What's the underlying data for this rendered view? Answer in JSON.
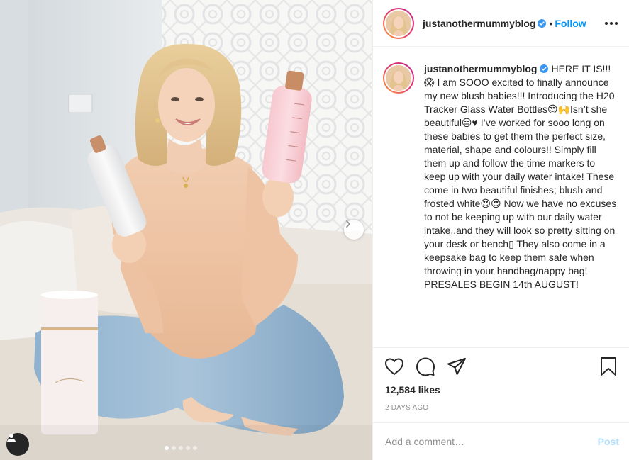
{
  "post": {
    "username": "justanothermummyblog",
    "header_separator": "•",
    "follow_label": "Follow",
    "caption": "HERE IT IS!!!😱 I am SOOO excited to finally announce my new blush babies!!! Introducing the H20 Tracker Glass Water Bottles😍🙌Isn’t she beautiful😑♥ I’ve worked for sooo long on these babies to get them the perfect size, material, shape and colours!! Simply fill them up and follow the time markers to keep up with your daily water intake! These come in two beautiful finishes; blush and frosted white😍😍 Now we have no excuses to not be keeping up with our daily water intake..and they will look so pretty sitting on your desk or bench▯ They also come in a keepsake bag to keep them safe when throwing in your handbag/nappy bag! PRESALES BEGIN 14th AUGUST!",
    "likes": "12,584 likes",
    "timestamp": "2 DAYS AGO",
    "comment_placeholder": "Add a comment…",
    "post_label": "Post",
    "carousel": {
      "count": 5,
      "active_index": 0
    }
  },
  "icons": {
    "verified": "verified-badge-icon",
    "more": "more-options-icon",
    "like": "heart-icon",
    "comment": "comment-bubble-icon",
    "share": "paper-plane-icon",
    "save": "bookmark-icon",
    "next": "chevron-right-icon",
    "tagged": "user-tag-icon"
  },
  "colors": {
    "follow": "#0095f6",
    "verified": "#3897f0",
    "post_disabled": "#b2dffc",
    "meta_gray": "#8e8e8e",
    "border": "#efefef",
    "story_ring_start": "#f9a23b",
    "story_ring_end": "#c1288f"
  }
}
